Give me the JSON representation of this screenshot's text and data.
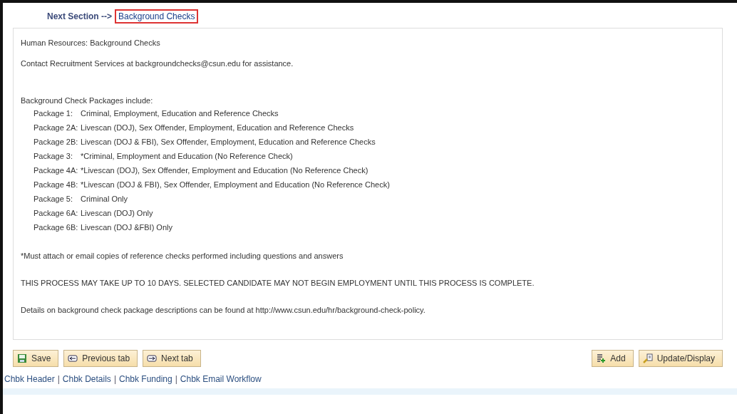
{
  "next_section": {
    "label": "Next Section -->",
    "link": "Background Checks",
    "highlighted": true
  },
  "info": {
    "title": "Human Resources: Background Checks",
    "contact": "Contact Recruitment Services at backgroundchecks@csun.edu for assistance.",
    "packages_heading": "Background Check Packages include:",
    "packages": [
      {
        "name": "Package 1:",
        "description": "Criminal, Employment, Education and Reference Checks"
      },
      {
        "name": "Package 2A:",
        "description": "Livescan (DOJ), Sex Offender, Employment, Education and Reference Checks"
      },
      {
        "name": "Package 2B:",
        "description": "Livescan (DOJ & FBI), Sex Offender, Employment, Education and Reference Checks"
      },
      {
        "name": "Package 3:",
        "description": "*Criminal, Employment and Education (No Reference Check)"
      },
      {
        "name": "Package 4A:",
        "description": "*Livescan (DOJ), Sex Offender, Employment and Education (No Reference Check)"
      },
      {
        "name": "Package 4B:",
        "description": "*Livescan (DOJ & FBI), Sex Offender, Employment and Education (No Reference Check)"
      },
      {
        "name": "Package 5:",
        "description": "Criminal Only"
      },
      {
        "name": "Package 6A:",
        "description": "Livescan (DOJ) Only"
      },
      {
        "name": "Package 6B:",
        "description": "Livescan (DOJ &FBI) Only"
      }
    ],
    "note": "*Must attach or email copies of reference checks performed including questions and answers",
    "warning": "THIS PROCESS MAY TAKE UP TO 10 DAYS. SELECTED CANDIDATE MAY NOT BEGIN EMPLOYMENT UNTIL THIS PROCESS IS COMPLETE.",
    "details": "Details on background check package descriptions can be found at http://www.csun.edu/hr/background-check-policy."
  },
  "left_buttons": [
    {
      "label": "Save",
      "kind": "save"
    },
    {
      "label": "Previous tab",
      "kind": "previous"
    },
    {
      "label": "Next tab",
      "kind": "next"
    }
  ],
  "right_buttons": [
    {
      "label": "Add",
      "kind": "add"
    },
    {
      "label": "Update/Display",
      "kind": "update"
    }
  ],
  "footer_links": [
    {
      "text": "Chbk Header",
      "kind": "link"
    },
    {
      "text": "|",
      "kind": "separator"
    },
    {
      "text": "Chbk Details",
      "kind": "link"
    },
    {
      "text": "|",
      "kind": "separator"
    },
    {
      "text": "Chbk Funding",
      "kind": "link"
    },
    {
      "text": "|",
      "kind": "separator"
    },
    {
      "text": "Chbk Email Workflow",
      "kind": "link"
    }
  ]
}
